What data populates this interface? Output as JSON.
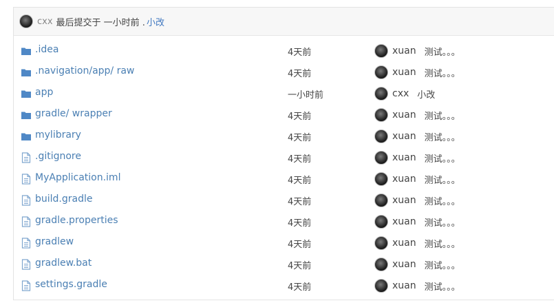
{
  "commit_bar": {
    "author": "cxx",
    "text": "最后提交于 一小时前 .",
    "message": "小改"
  },
  "files": [
    {
      "type": "folder",
      "name": ".idea",
      "time": "4天前",
      "author": "xuan",
      "message": "测试。。。"
    },
    {
      "type": "folder",
      "name": ".navigation/app/ raw",
      "time": "4天前",
      "author": "xuan",
      "message": "测试。。。"
    },
    {
      "type": "folder",
      "name": "app",
      "time": "一小时前",
      "author": "cxx",
      "message": "小改"
    },
    {
      "type": "folder",
      "name": "gradle/ wrapper",
      "time": "4天前",
      "author": "xuan",
      "message": "测试。。。"
    },
    {
      "type": "folder",
      "name": "mylibrary",
      "time": "4天前",
      "author": "xuan",
      "message": "测试。。。"
    },
    {
      "type": "file",
      "name": ".gitignore",
      "time": "4天前",
      "author": "xuan",
      "message": "测试。。。"
    },
    {
      "type": "file",
      "name": "MyApplication.iml",
      "time": "4天前",
      "author": "xuan",
      "message": "测试。。。"
    },
    {
      "type": "file",
      "name": "build.gradle",
      "time": "4天前",
      "author": "xuan",
      "message": "测试。。。"
    },
    {
      "type": "file",
      "name": "gradle.properties",
      "time": "4天前",
      "author": "xuan",
      "message": "测试。。。"
    },
    {
      "type": "file",
      "name": "gradlew",
      "time": "4天前",
      "author": "xuan",
      "message": "测试。。。"
    },
    {
      "type": "file",
      "name": "gradlew.bat",
      "time": "4天前",
      "author": "xuan",
      "message": "测试。。。"
    },
    {
      "type": "file",
      "name": "settings.gradle",
      "time": "4天前",
      "author": "xuan",
      "message": "测试。。。"
    }
  ],
  "colors": {
    "link": "#4a7fb3",
    "folder_icon": "#4f88c6",
    "file_icon": "#7fa6cf"
  }
}
